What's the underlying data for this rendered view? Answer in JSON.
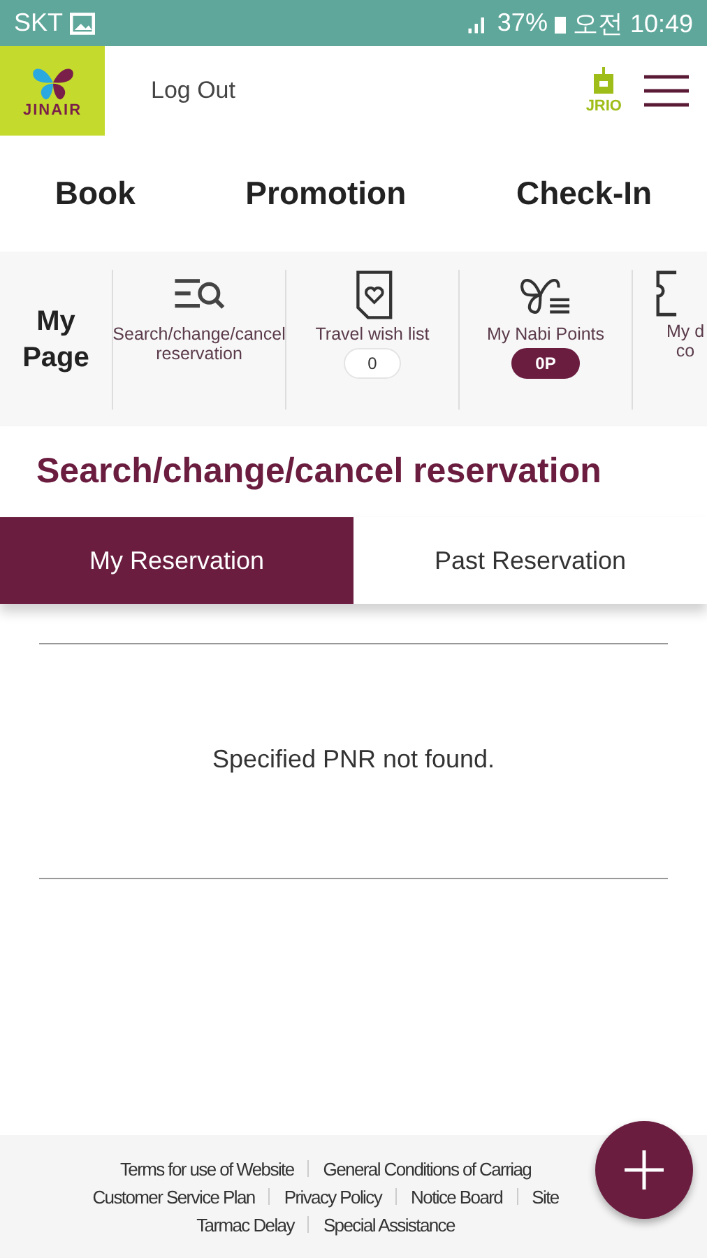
{
  "status_bar": {
    "carrier": "SKT",
    "battery": "37%",
    "time": "오전 10:49"
  },
  "header": {
    "logo_text": "JINAIR",
    "logout": "Log Out",
    "jrio_text": "JRIO"
  },
  "nav": [
    "Book",
    "Promotion",
    "Check-In"
  ],
  "my_page": {
    "title": "My Page",
    "items": [
      {
        "label": "Search/change/cancel reservation",
        "kind": "search"
      },
      {
        "label": "Travel wish list",
        "kind": "wish",
        "badge": "0",
        "badge_filled": false
      },
      {
        "label": "My Nabi Points",
        "kind": "points",
        "badge": "0P",
        "badge_filled": true
      },
      {
        "label": "My d co",
        "kind": "coupon"
      }
    ]
  },
  "section_title": "Search/change/cancel reservation",
  "tabs": [
    {
      "label": "My Reservation",
      "selected": true
    },
    {
      "label": "Past Reservation",
      "selected": false
    }
  ],
  "message": "Specified PNR not found.",
  "footer_rows": [
    [
      "Terms for use of Website",
      "General Conditions of Carriag"
    ],
    [
      "Customer Service Plan",
      "Privacy Policy",
      "Notice Board",
      "Site"
    ],
    [
      "Tarmac Delay",
      "Special Assistance"
    ]
  ]
}
